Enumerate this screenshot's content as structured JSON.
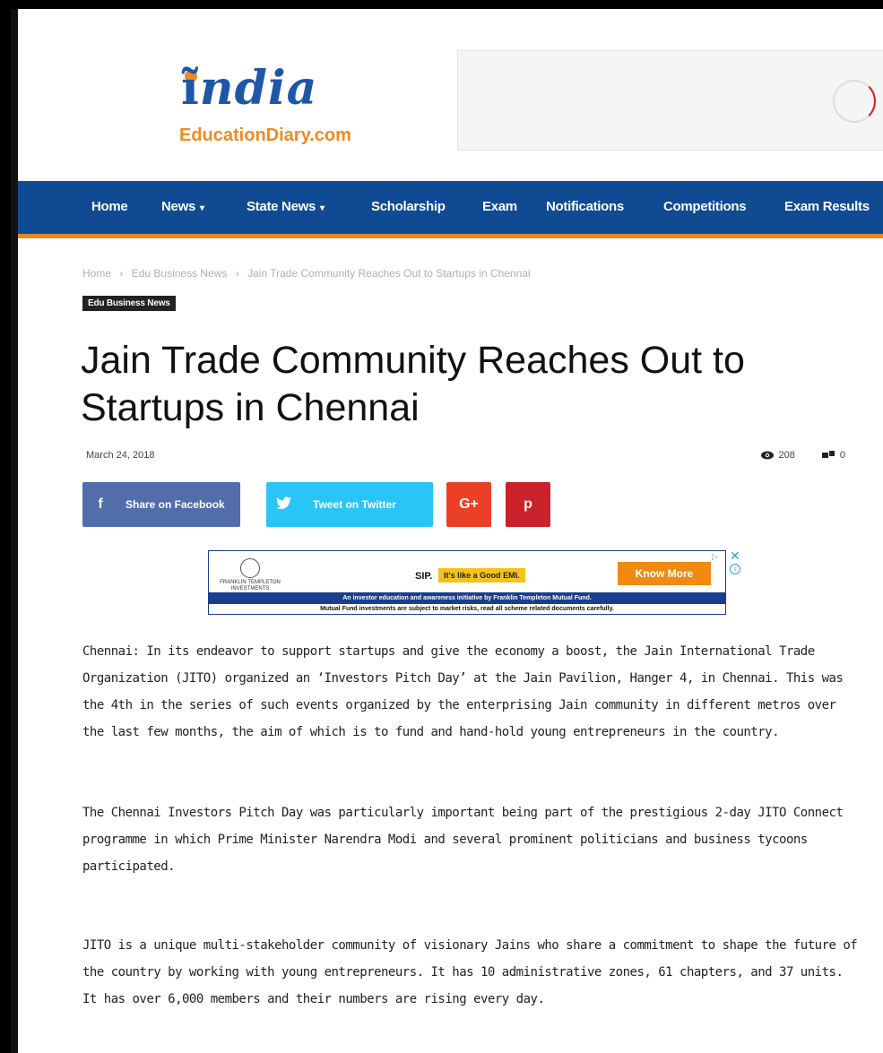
{
  "logo": {
    "india": "ndia",
    "domain": "EducationDiary.com"
  },
  "nav": {
    "items": [
      {
        "label": "Home",
        "dropdown": false
      },
      {
        "label": "News",
        "dropdown": true
      },
      {
        "label": "State News",
        "dropdown": true
      },
      {
        "label": "Scholarship",
        "dropdown": false
      },
      {
        "label": "Exam",
        "dropdown": false
      },
      {
        "label": "Notifications",
        "dropdown": false
      },
      {
        "label": "Competitions",
        "dropdown": false
      },
      {
        "label": "Exam Results",
        "dropdown": false
      }
    ],
    "chevron": "⌄"
  },
  "breadcrumb": {
    "home": "Home",
    "category": "Edu Business News",
    "current": "Jain Trade Community Reaches Out to Startups in Chennai",
    "separator": "›"
  },
  "category_tag": "Edu Business News",
  "article": {
    "title": "Jain Trade Community Reaches Out to Startups in Chennai",
    "date": "March 24, 2018",
    "views": "208",
    "comments": "0",
    "paragraphs": [
      "Chennai: In its endeavor to support startups and give the economy a boost, the Jain International Trade Organization (JITO) organized an ‘Investors Pitch Day’ at the Jain Pavilion, Hanger 4, in Chennai. This was the 4th in the series of such events organized by the enterprising Jain community in different metros over the last few months, the aim of which is to fund and hand-hold young entrepreneurs in the country.",
      "The Chennai Investors Pitch Day was particularly important being part of the prestigious 2-day JITO Connect programme in which Prime Minister Narendra Modi and several prominent politicians and business tycoons participated.",
      "JITO is a unique multi-stakeholder community of visionary Jains who share a commitment to shape the future of the country by working with young entrepreneurs. It has 10 administrative zones, 61 chapters, and 37 units. It has over 6,000 members and their numbers are rising every day."
    ]
  },
  "share": {
    "facebook": "Share on Facebook",
    "twitter": "Tweet on Twitter",
    "googleplus": "G+",
    "facebook_icon": "f",
    "pinterest_icon": "p"
  },
  "ad": {
    "brand": "FRANKLIN TEMPLETON INVESTMENTS",
    "sip": "SIP.",
    "sip_tag": "It's like a Good EMI.",
    "cta": "Know More",
    "line1": "An investor education and awareness initiative by Franklin Templeton Mutual Fund.",
    "line2": "Mutual Fund investments are subject to market risks, read all scheme related documents carefully.",
    "close": "✕",
    "info": "i"
  },
  "colors": {
    "nav_bg": "#0f4a92",
    "nav_border": "#e4891f",
    "facebook": "#516eab",
    "twitter": "#29c5f6",
    "googleplus": "#eb4026",
    "pinterest": "#ca212a"
  }
}
